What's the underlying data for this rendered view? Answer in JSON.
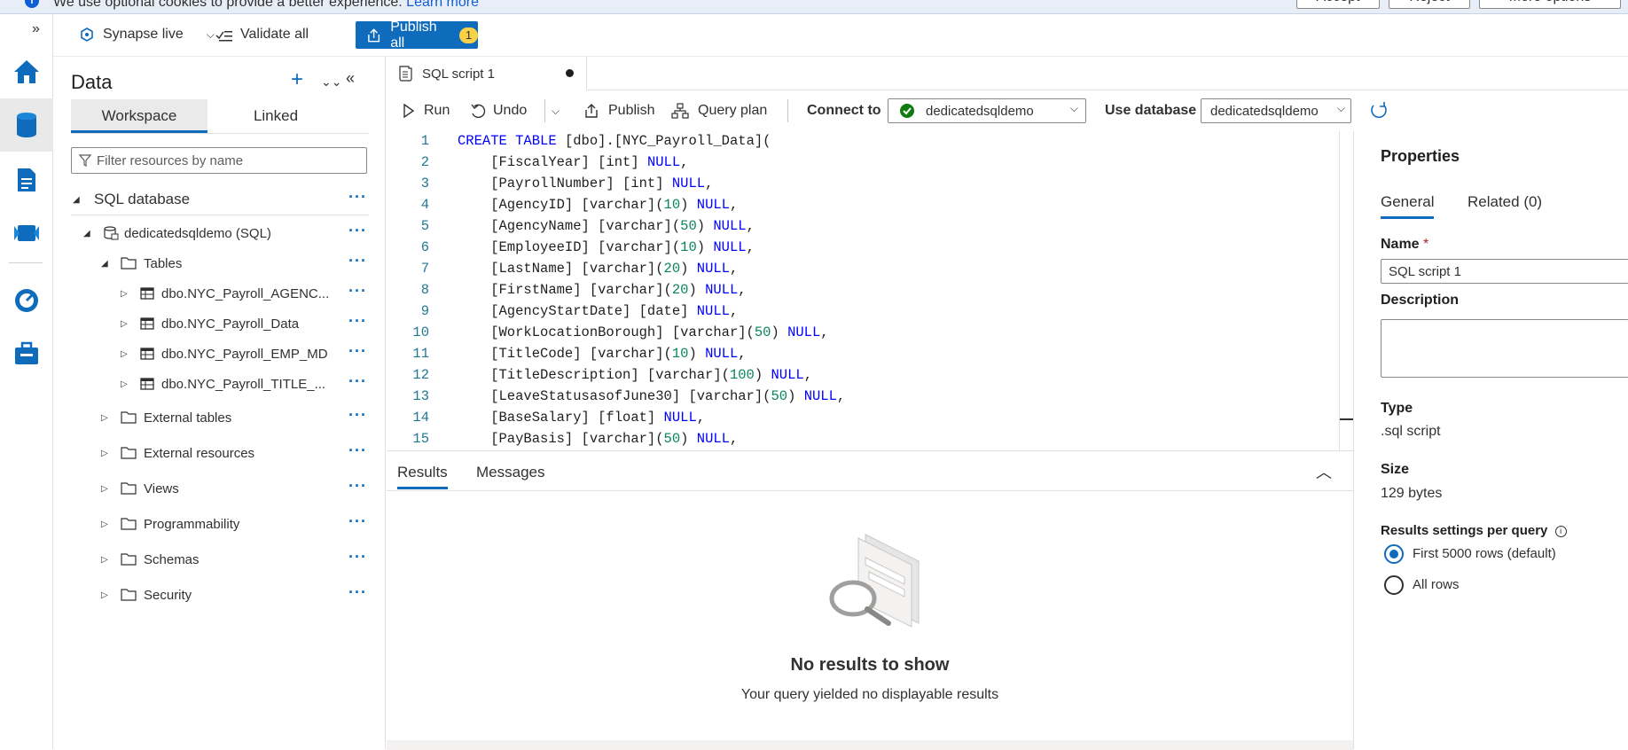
{
  "cookie_bar": {
    "message": "We use optional cookies to provide a better experience.",
    "learn_more": "Learn more",
    "accept": "Accept",
    "reject": "Reject",
    "more_options": "More options"
  },
  "topbar": {
    "mode_label": "Synapse live",
    "validate_label": "Validate all",
    "publish_label": "Publish all",
    "publish_count": "1"
  },
  "data_pane": {
    "title": "Data",
    "tabs": [
      "Workspace",
      "Linked"
    ],
    "filter_placeholder": "Filter resources by name",
    "section": "SQL database",
    "database": "dedicatedsqldemo (SQL)",
    "tree": [
      {
        "label": "Tables",
        "kind": "folder",
        "expanded": true
      },
      {
        "label": "dbo.NYC_Payroll_AGENC...",
        "kind": "table"
      },
      {
        "label": "dbo.NYC_Payroll_Data",
        "kind": "table"
      },
      {
        "label": "dbo.NYC_Payroll_EMP_MD",
        "kind": "table"
      },
      {
        "label": "dbo.NYC_Payroll_TITLE_...",
        "kind": "table"
      },
      {
        "label": "External tables",
        "kind": "folder"
      },
      {
        "label": "External resources",
        "kind": "folder"
      },
      {
        "label": "Views",
        "kind": "folder"
      },
      {
        "label": "Programmability",
        "kind": "folder"
      },
      {
        "label": "Schemas",
        "kind": "folder"
      },
      {
        "label": "Security",
        "kind": "folder"
      }
    ]
  },
  "editor": {
    "tab_title": "SQL script 1",
    "toolbar": {
      "run": "Run",
      "undo": "Undo",
      "publish": "Publish",
      "query_plan": "Query plan",
      "connect_to_label": "Connect to",
      "connect_to_value": "dedicatedsqldemo",
      "use_database_label": "Use database",
      "use_database_value": "dedicatedsqldemo"
    },
    "code_lines": [
      "CREATE TABLE [dbo].[NYC_Payroll_Data](",
      "    [FiscalYear] [int] NULL,",
      "    [PayrollNumber] [int] NULL,",
      "    [AgencyID] [varchar](10) NULL,",
      "    [AgencyName] [varchar](50) NULL,",
      "    [EmployeeID] [varchar](10) NULL,",
      "    [LastName] [varchar](20) NULL,",
      "    [FirstName] [varchar](20) NULL,",
      "    [AgencyStartDate] [date] NULL,",
      "    [WorkLocationBorough] [varchar](50) NULL,",
      "    [TitleCode] [varchar](10) NULL,",
      "    [TitleDescription] [varchar](100) NULL,",
      "    [LeaveStatusasofJune30] [varchar](50) NULL,",
      "    [BaseSalary] [float] NULL,",
      "    [PayBasis] [varchar](50) NULL,"
    ]
  },
  "results": {
    "tabs": [
      "Results",
      "Messages"
    ],
    "empty_title": "No results to show",
    "empty_subtitle": "Your query yielded no displayable results"
  },
  "properties": {
    "title": "Properties",
    "tabs": [
      "General",
      "Related (0)"
    ],
    "name_label": "Name",
    "name_required": "*",
    "name_value": "SQL script 1",
    "description_label": "Description",
    "type_label": "Type",
    "type_value": ".sql script",
    "size_label": "Size",
    "size_value": "129 bytes",
    "results_settings_label": "Results settings per query",
    "radio_options": [
      "First 5000 rows (default)",
      "All rows"
    ],
    "selected_option": "First 5000 rows (default)"
  },
  "colors": {
    "accent": "#0f6cbd",
    "keyword": "#0000ff",
    "number": "#098658",
    "line_number": "#237893"
  }
}
